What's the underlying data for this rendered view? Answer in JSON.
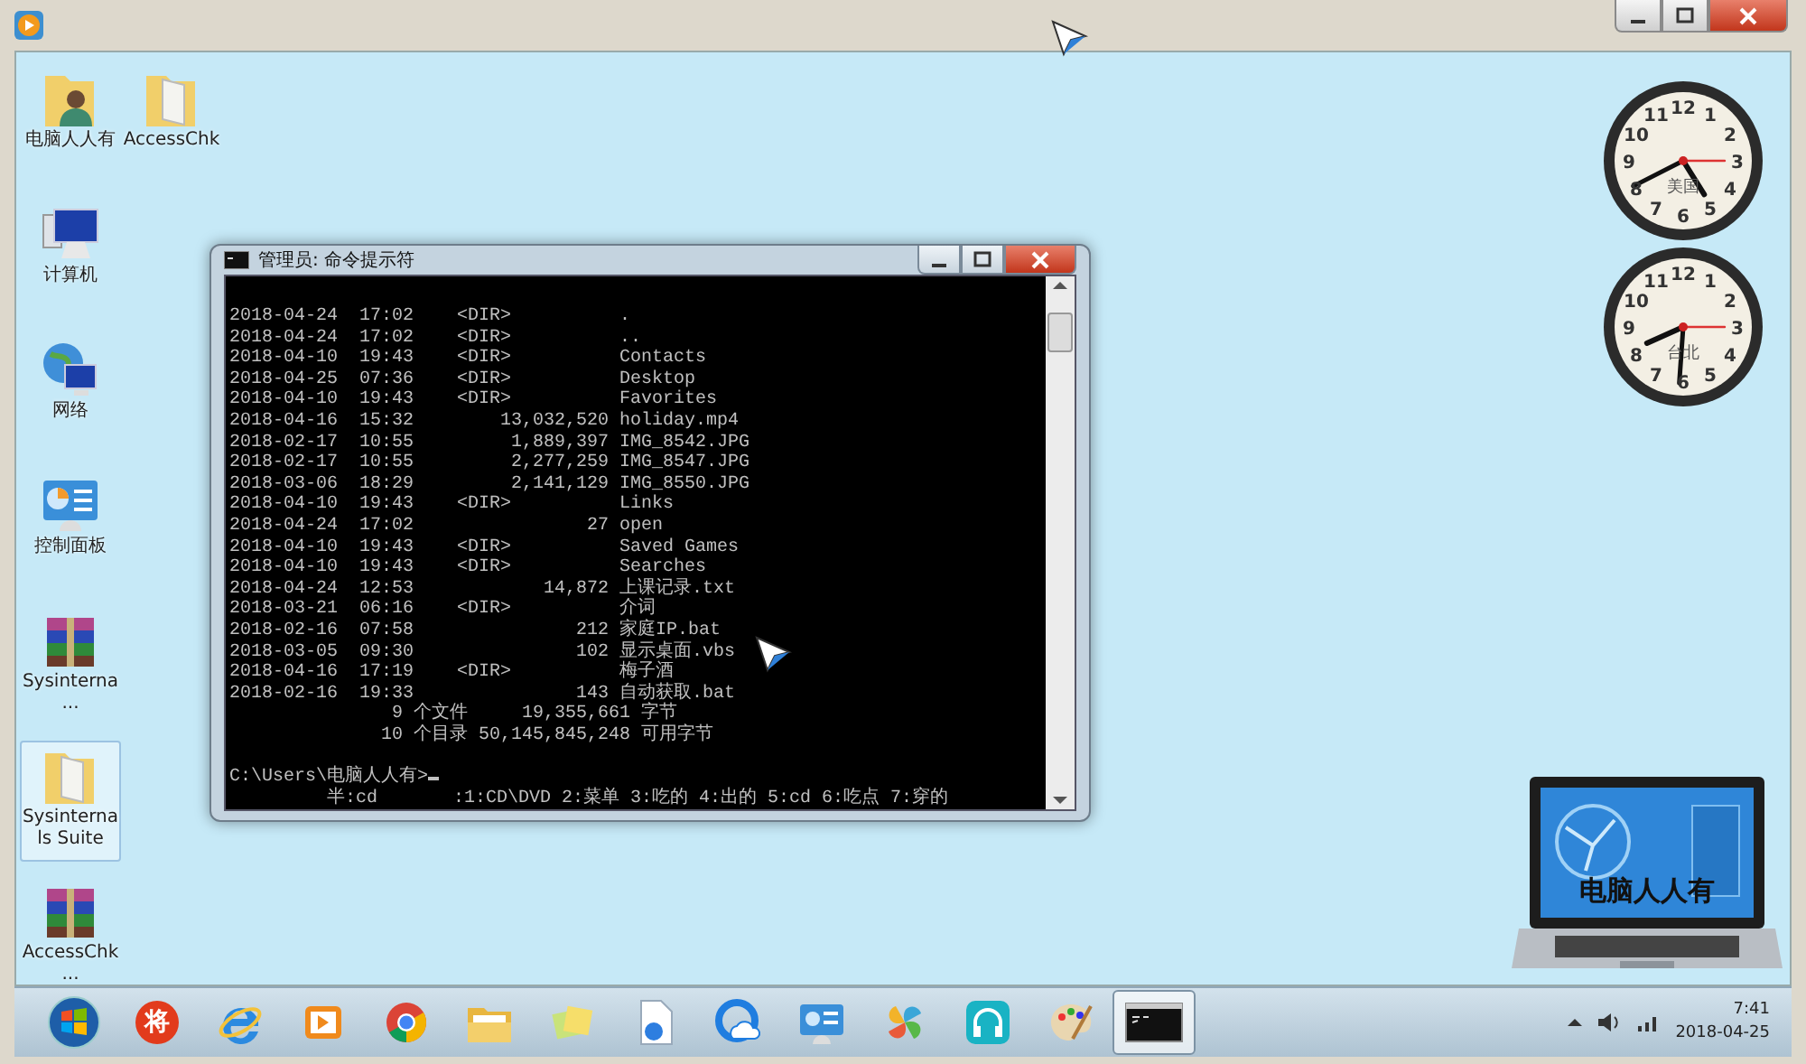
{
  "desktop_icons": [
    {
      "label": "电脑人人有",
      "kind": "user-folder",
      "selected": false
    },
    {
      "label": "AccessChk",
      "kind": "folder",
      "selected": false
    },
    {
      "label": "计算机",
      "kind": "computer",
      "selected": false
    },
    {
      "label": "网络",
      "kind": "network",
      "selected": false
    },
    {
      "label": "控制面板",
      "kind": "control-panel",
      "selected": false
    },
    {
      "label": "Sysinterna...",
      "kind": "archive",
      "selected": false
    },
    {
      "label": "Sysinternals Suite",
      "kind": "folder",
      "selected": true
    },
    {
      "label": "AccessChk...",
      "kind": "archive",
      "selected": false
    }
  ],
  "console": {
    "title": "管理员: 命令提示符",
    "lines": [
      "2018-04-24  17:02    <DIR>          .",
      "2018-04-24  17:02    <DIR>          ..",
      "2018-04-10  19:43    <DIR>          Contacts",
      "2018-04-25  07:36    <DIR>          Desktop",
      "2018-04-10  19:43    <DIR>          Favorites",
      "2018-04-16  15:32        13,032,520 holiday.mp4",
      "2018-02-17  10:55         1,889,397 IMG_8542.JPG",
      "2018-02-17  10:55         2,277,259 IMG_8547.JPG",
      "2018-03-06  18:29         2,141,129 IMG_8550.JPG",
      "2018-04-10  19:43    <DIR>          Links",
      "2018-04-24  17:02                27 open",
      "2018-04-10  19:43    <DIR>          Saved Games",
      "2018-04-10  19:43    <DIR>          Searches",
      "2018-04-24  12:53            14,872 上课记录.txt",
      "2018-03-21  06:16    <DIR>          介词",
      "2018-02-16  07:58               212 家庭IP.bat",
      "2018-03-05  09:30               102 显示桌面.vbs",
      "2018-04-16  17:19    <DIR>          梅子酒",
      "2018-02-16  19:33               143 自动获取.bat",
      "               9 个文件     19,355,661 字节",
      "              10 个目录 50,145,845,248 可用字节"
    ],
    "prompt": "C:\\Users\\电脑人人有>",
    "ime_bar": "         半:cd       :1:CD\\DVD 2:菜单 3:吃的 4:出的 5:cd 6:吃点 7:穿的"
  },
  "clocks": [
    {
      "city": "美国",
      "numerals": [
        "12",
        "11",
        "1",
        "10",
        "2",
        "9",
        "3",
        "8",
        "4",
        "7",
        "5",
        "6"
      ]
    },
    {
      "city": "台北",
      "numerals": [
        "12",
        "11",
        "1",
        "10",
        "2",
        "9",
        "3",
        "8",
        "4",
        "7",
        "5",
        "6"
      ]
    }
  ],
  "laptop_gadget": {
    "caption": "电脑人人有"
  },
  "taskbar": {
    "items": [
      {
        "kind": "start",
        "selected": false
      },
      {
        "kind": "badge",
        "text": "将",
        "selected": false
      },
      {
        "kind": "ie",
        "selected": false
      },
      {
        "kind": "player",
        "selected": false
      },
      {
        "kind": "chrome",
        "selected": false
      },
      {
        "kind": "explorer",
        "selected": false
      },
      {
        "kind": "notes",
        "selected": false
      },
      {
        "kind": "document",
        "selected": false
      },
      {
        "kind": "cloud",
        "selected": false
      },
      {
        "kind": "panel",
        "selected": false
      },
      {
        "kind": "pinwheel",
        "selected": false
      },
      {
        "kind": "headset",
        "selected": false
      },
      {
        "kind": "paint",
        "selected": false
      },
      {
        "kind": "console",
        "selected": true
      }
    ],
    "time": "7:41",
    "date": "2018-04-25"
  }
}
